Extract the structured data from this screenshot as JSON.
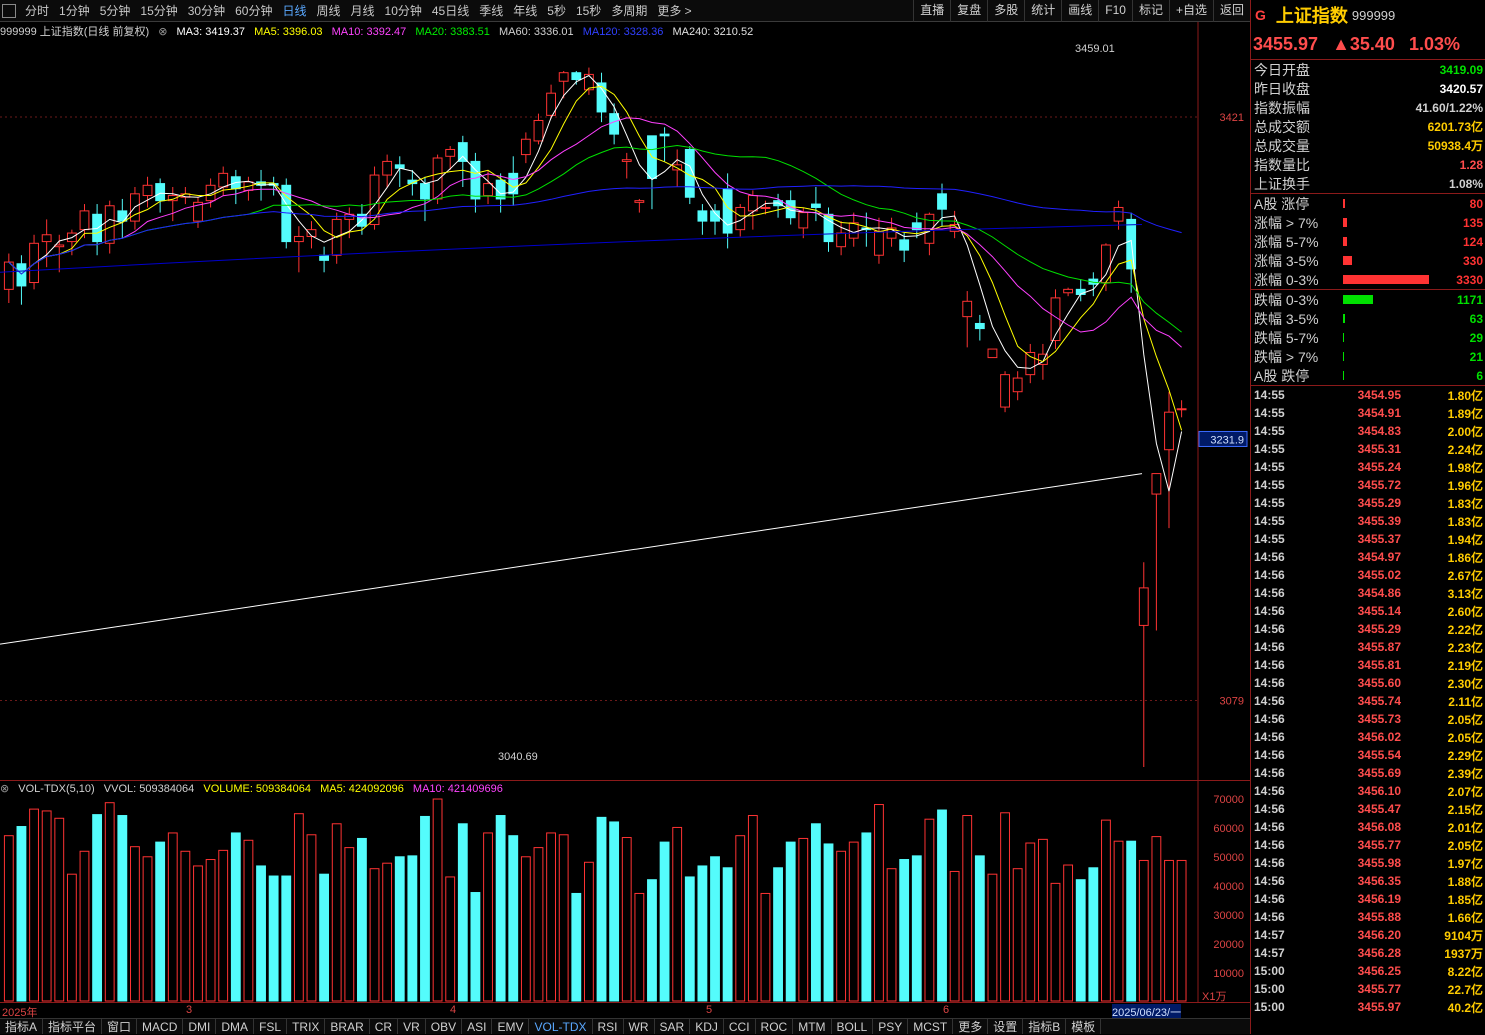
{
  "colors": {
    "up": "#ff3333",
    "down": "#54fcfc",
    "ma3": "#ffffff",
    "ma5": "#ffff00",
    "ma10": "#ff40ff",
    "ma20": "#00e000",
    "ma60": "#2020ff",
    "ma120": "#0000cc",
    "ma240": "#ffffff",
    "vol_ma5": "#ffff00",
    "vol_ma10": "#ff40ff"
  },
  "top_toolbar": {
    "periods": [
      "分时",
      "1分钟",
      "5分钟",
      "15分钟",
      "30分钟",
      "60分钟",
      "日线",
      "周线",
      "月线",
      "10分钟",
      "45日线",
      "季线",
      "年线",
      "5秒",
      "15秒",
      "多周期",
      "更多 >"
    ],
    "active_period": "日线",
    "tools": [
      "直播",
      "复盘",
      "多股",
      "统计",
      "画线",
      "F10",
      "标记",
      "+自选",
      "返回"
    ]
  },
  "chart_header": {
    "title": "999999 上证指数(日线 前复权)",
    "ma3": "MA3: 3419.37",
    "ma5": "MA5: 3396.03",
    "ma10": "MA10: 3392.47",
    "ma20": "MA20: 3383.51",
    "ma60": "MA60: 3336.01",
    "ma120": "MA120: 3328.36",
    "ma240": "MA240: 3210.52"
  },
  "price_axis": {
    "labels": [
      "3421",
      "3231.9",
      "3079"
    ],
    "highlight": "3231.9"
  },
  "annotations": {
    "high": "3459.01",
    "low": "3040.69"
  },
  "volume_header": {
    "name": "VOL-TDX(5,10)",
    "vvol": "VVOL: 509384064",
    "volume": "VOLUME: 509384064",
    "ma5": "MA5: 424092096",
    "ma10": "MA10: 421409696"
  },
  "volume_axis": {
    "labels": [
      "70000",
      "60000",
      "50000",
      "40000",
      "30000",
      "20000",
      "10000"
    ],
    "unit": "X1万"
  },
  "date_axis": {
    "labels": [
      "2025年",
      "3",
      "4",
      "5",
      "6"
    ],
    "current": "2025/06/23/一"
  },
  "bottom_tabs": [
    "指标A",
    "指标平台",
    "窗口",
    "MACD",
    "DMI",
    "DMA",
    "FSL",
    "TRIX",
    "BRAR",
    "CR",
    "VR",
    "OBV",
    "ASI",
    "EMV",
    "VOL-TDX",
    "RSI",
    "WR",
    "SAR",
    "KDJ",
    "CCI",
    "ROC",
    "MTM",
    "BOLL",
    "PSY",
    "MCST",
    "更多",
    "设置",
    "指标B",
    "模板"
  ],
  "active_bottom_tab": "VOL-TDX",
  "chart_data": {
    "type": "candlestick",
    "title": "999999 上证指数(日线 前复权)",
    "series_name": "上证指数",
    "ylim": [
      3040,
      3465
    ],
    "candles": [
      [
        3320,
        3336,
        3312,
        3341
      ],
      [
        3335,
        3322,
        3311,
        3340
      ],
      [
        3324,
        3347,
        3320,
        3352
      ],
      [
        3348,
        3352,
        3333,
        3361
      ],
      [
        3345,
        3346,
        3330,
        3352
      ],
      [
        3348,
        3353,
        3340,
        3355
      ],
      [
        3355,
        3366,
        3350,
        3370
      ],
      [
        3364,
        3348,
        3340,
        3370
      ],
      [
        3347,
        3369,
        3341,
        3372
      ],
      [
        3366,
        3360,
        3350,
        3373
      ],
      [
        3360,
        3376,
        3355,
        3380
      ],
      [
        3375,
        3381,
        3368,
        3386
      ],
      [
        3382,
        3372,
        3365,
        3385
      ],
      [
        3372,
        3375,
        3360,
        3380
      ],
      [
        3374,
        3376,
        3370,
        3380
      ],
      [
        3360,
        3371,
        3356,
        3374
      ],
      [
        3372,
        3381,
        3368,
        3385
      ],
      [
        3380,
        3388,
        3375,
        3392
      ],
      [
        3386,
        3379,
        3370,
        3390
      ],
      [
        3378,
        3383,
        3372,
        3386
      ],
      [
        3383,
        3381,
        3372,
        3390
      ],
      [
        3382,
        3381,
        3375,
        3386
      ],
      [
        3381,
        3348,
        3344,
        3385
      ],
      [
        3348,
        3351,
        3330,
        3357
      ],
      [
        3351,
        3355,
        3344,
        3360
      ],
      [
        3340,
        3337,
        3330,
        3345
      ],
      [
        3340,
        3361,
        3335,
        3365
      ],
      [
        3361,
        3364,
        3350,
        3368
      ],
      [
        3364,
        3357,
        3352,
        3370
      ],
      [
        3358,
        3387,
        3355,
        3392
      ],
      [
        3387,
        3395,
        3380,
        3399
      ],
      [
        3393,
        3391,
        3380,
        3398
      ],
      [
        3384,
        3382,
        3375,
        3390
      ],
      [
        3382,
        3373,
        3360,
        3386
      ],
      [
        3373,
        3397,
        3370,
        3399
      ],
      [
        3398,
        3402,
        3390,
        3404
      ],
      [
        3406,
        3395,
        3380,
        3410
      ],
      [
        3395,
        3373,
        3365,
        3400
      ],
      [
        3375,
        3382,
        3370,
        3390
      ],
      [
        3384,
        3373,
        3365,
        3388
      ],
      [
        3388,
        3376,
        3369,
        3398
      ],
      [
        3399,
        3408,
        3394,
        3412
      ],
      [
        3407,
        3419,
        3405,
        3423
      ],
      [
        3422,
        3435,
        3420,
        3440
      ],
      [
        3442,
        3447,
        3432,
        3448
      ],
      [
        3447,
        3443,
        3440,
        3448
      ],
      [
        3437,
        3446,
        3434,
        3450
      ],
      [
        3441,
        3424,
        3418,
        3447
      ],
      [
        3423,
        3411,
        3405,
        3429
      ],
      [
        3395,
        3396,
        3385,
        3400
      ],
      [
        3371,
        3372,
        3365,
        3373
      ],
      [
        3410,
        3385,
        3367,
        3410
      ],
      [
        3411,
        3410,
        3395,
        3415
      ],
      [
        3390,
        3393,
        3380,
        3402
      ],
      [
        3402,
        3374,
        3370,
        3404
      ],
      [
        3366,
        3360,
        3352,
        3370
      ],
      [
        3366,
        3360,
        3352,
        3370
      ],
      [
        3379,
        3353,
        3344,
        3388
      ],
      [
        3355,
        3368,
        3351,
        3370
      ],
      [
        3366,
        3375,
        3355,
        3378
      ],
      [
        3368,
        3368,
        3364,
        3372
      ],
      [
        3372,
        3369,
        3362,
        3376
      ],
      [
        3372,
        3362,
        3358,
        3378
      ],
      [
        3356,
        3365,
        3350,
        3368
      ],
      [
        3370,
        3368,
        3360,
        3380
      ],
      [
        3364,
        3348,
        3342,
        3368
      ],
      [
        3345,
        3353,
        3340,
        3360
      ],
      [
        3350,
        3359,
        3345,
        3365
      ],
      [
        3356,
        3355,
        3345,
        3365
      ],
      [
        3340,
        3354,
        3335,
        3362
      ],
      [
        3350,
        3356,
        3345,
        3362
      ],
      [
        3349,
        3343,
        3336,
        3353
      ],
      [
        3359,
        3355,
        3350,
        3365
      ],
      [
        3347,
        3364,
        3340,
        3365
      ],
      [
        3376,
        3367,
        3357,
        3382
      ],
      [
        3354,
        3358,
        3350,
        3366
      ],
      [
        3304,
        3313,
        3286,
        3319
      ],
      [
        3300,
        3297,
        3290,
        3305
      ],
      [
        3280,
        3285,
        3280,
        3285
      ],
      [
        3251,
        3270,
        3248,
        3272
      ],
      [
        3260,
        3268,
        3255,
        3272
      ],
      [
        3270,
        3283,
        3265,
        3288
      ],
      [
        3276,
        3282,
        3267,
        3288
      ],
      [
        3290,
        3315,
        3285,
        3320
      ],
      [
        3318,
        3320,
        3316,
        3321
      ],
      [
        3320,
        3317,
        3313,
        3326
      ],
      [
        3326,
        3323,
        3316,
        3330
      ],
      [
        3324,
        3346,
        3319,
        3347
      ],
      [
        3360,
        3368,
        3355,
        3372
      ],
      [
        3361,
        3332,
        3318,
        3365
      ],
      [
        3123,
        3145,
        3040,
        3160
      ],
      [
        3200,
        3212,
        3120,
        3212
      ],
      [
        3226,
        3248,
        3180,
        3260
      ],
      [
        3250,
        3250,
        3245,
        3255
      ]
    ]
  },
  "right_panel": {
    "name": "上证指数",
    "code": "999999",
    "mark": "G",
    "price": "3455.97",
    "change": "▲35.40",
    "pct": "1.03%",
    "stats": [
      {
        "label": "今日开盘",
        "value": "3419.09",
        "color": "#00e000"
      },
      {
        "label": "昨日收盘",
        "value": "3420.57",
        "color": "#ffffff"
      },
      {
        "label": "指数振幅",
        "value": "41.60/1.22%",
        "color": "#d0d0d0"
      },
      {
        "label": "总成交额",
        "value": "6201.73亿",
        "color": "#ffcc00"
      },
      {
        "label": "总成交量",
        "value": "50938.4万",
        "color": "#ffcc00"
      },
      {
        "label": "指数量比",
        "value": "1.28",
        "color": "#ff4d4d"
      },
      {
        "label": "上证换手",
        "value": "1.08%",
        "color": "#d0d0d0"
      }
    ],
    "breadth_up": [
      {
        "label": "A股 涨停",
        "value": "80",
        "bar": 2
      },
      {
        "label": "涨幅 > 7%",
        "value": "135",
        "bar": 4
      },
      {
        "label": "涨幅 5-7%",
        "value": "124",
        "bar": 4
      },
      {
        "label": "涨幅 3-5%",
        "value": "330",
        "bar": 9
      },
      {
        "label": "涨幅 0-3%",
        "value": "3330",
        "bar": 86
      }
    ],
    "breadth_down": [
      {
        "label": "跌幅 0-3%",
        "value": "1171",
        "bar": 30
      },
      {
        "label": "跌幅 3-5%",
        "value": "63",
        "bar": 2
      },
      {
        "label": "跌幅 5-7%",
        "value": "29",
        "bar": 1
      },
      {
        "label": "跌幅 > 7%",
        "value": "21",
        "bar": 1
      },
      {
        "label": "A股 跌停",
        "value": "6",
        "bar": 1
      }
    ],
    "ticks": [
      [
        "14:55",
        "3454.95",
        "1.80亿"
      ],
      [
        "14:55",
        "3454.91",
        "1.89亿"
      ],
      [
        "14:55",
        "3454.83",
        "2.00亿"
      ],
      [
        "14:55",
        "3455.31",
        "2.24亿"
      ],
      [
        "14:55",
        "3455.24",
        "1.98亿"
      ],
      [
        "14:55",
        "3455.72",
        "1.96亿"
      ],
      [
        "14:55",
        "3455.29",
        "1.83亿"
      ],
      [
        "14:55",
        "3455.39",
        "1.83亿"
      ],
      [
        "14:55",
        "3455.37",
        "1.94亿"
      ],
      [
        "14:56",
        "3454.97",
        "1.86亿"
      ],
      [
        "14:56",
        "3455.02",
        "2.67亿"
      ],
      [
        "14:56",
        "3454.86",
        "3.13亿"
      ],
      [
        "14:56",
        "3455.14",
        "2.60亿"
      ],
      [
        "14:56",
        "3455.29",
        "2.22亿"
      ],
      [
        "14:56",
        "3455.87",
        "2.23亿"
      ],
      [
        "14:56",
        "3455.81",
        "2.19亿"
      ],
      [
        "14:56",
        "3455.60",
        "2.30亿"
      ],
      [
        "14:56",
        "3455.74",
        "2.11亿"
      ],
      [
        "14:56",
        "3455.73",
        "2.05亿"
      ],
      [
        "14:56",
        "3456.02",
        "2.05亿"
      ],
      [
        "14:56",
        "3455.54",
        "2.29亿"
      ],
      [
        "14:56",
        "3455.69",
        "2.39亿"
      ],
      [
        "14:56",
        "3456.10",
        "2.07亿"
      ],
      [
        "14:56",
        "3455.47",
        "2.15亿"
      ],
      [
        "14:56",
        "3456.08",
        "2.01亿"
      ],
      [
        "14:56",
        "3455.77",
        "2.05亿"
      ],
      [
        "14:56",
        "3455.98",
        "1.97亿"
      ],
      [
        "14:56",
        "3456.35",
        "1.88亿"
      ],
      [
        "14:56",
        "3456.19",
        "1.85亿"
      ],
      [
        "14:56",
        "3455.88",
        "1.66亿"
      ],
      [
        "14:57",
        "3456.20",
        "9104万"
      ],
      [
        "14:57",
        "3456.28",
        "1937万"
      ],
      [
        "15:00",
        "3456.25",
        "8.22亿"
      ],
      [
        "15:00",
        "3455.77",
        "22.7亿"
      ],
      [
        "15:00",
        "3455.97",
        "40.2亿"
      ]
    ]
  }
}
